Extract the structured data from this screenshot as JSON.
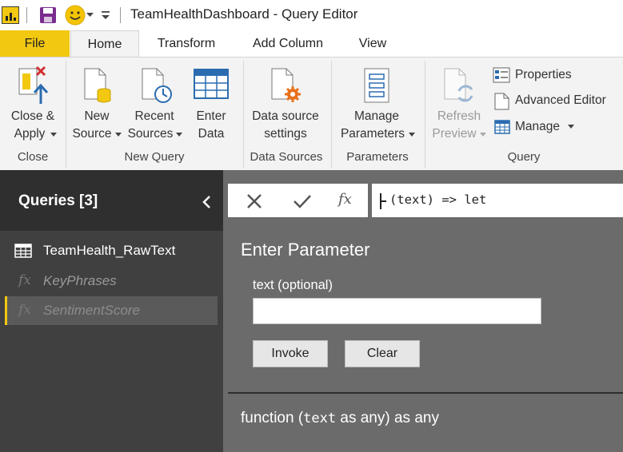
{
  "titlebar": {
    "title": "TeamHealthDashboard - Query Editor",
    "icons": [
      "powerbi-icon",
      "save-icon",
      "smiley-icon",
      "customize-dropdown-icon"
    ]
  },
  "tabs": [
    {
      "label": "File"
    },
    {
      "label": "Home"
    },
    {
      "label": "Transform"
    },
    {
      "label": "Add Column"
    },
    {
      "label": "View"
    }
  ],
  "ribbon": {
    "close": {
      "l1": "Close &",
      "l2": "Apply",
      "group": "Close"
    },
    "new_source": {
      "l1": "New",
      "l2": "Source"
    },
    "recent_sources": {
      "l1": "Recent",
      "l2": "Sources"
    },
    "enter_data": {
      "l1": "Enter",
      "l2": "Data"
    },
    "new_query_group": "New Query",
    "data_source_settings": {
      "l1": "Data source",
      "l2": "settings"
    },
    "data_sources_group": "Data Sources",
    "manage_parameters": {
      "l1": "Manage",
      "l2": "Parameters"
    },
    "parameters_group": "Parameters",
    "refresh_preview": {
      "l1": "Refresh",
      "l2": "Preview"
    },
    "properties": "Properties",
    "advanced_editor": "Advanced Editor",
    "manage": "Manage",
    "query_group": "Query"
  },
  "queries": {
    "header": "Queries [3]",
    "items": [
      {
        "label": "TeamHealth_RawText",
        "icon": "table-icon"
      },
      {
        "label": "KeyPhrases",
        "icon": "function-icon"
      },
      {
        "label": "SentimentScore",
        "icon": "function-icon",
        "selected": true
      }
    ]
  },
  "formula_bar": {
    "text": "(text) => let"
  },
  "enter_parameter": {
    "title": "Enter Parameter",
    "param_label": "text (optional)",
    "param_value": "",
    "invoke": "Invoke",
    "clear": "Clear"
  },
  "signature": {
    "pre": "function (",
    "mono": "text",
    "post": " as any) as any"
  },
  "colors": {
    "accent": "#f2c811",
    "pane_dark": "#404040",
    "main_gray": "#6b6b6b"
  }
}
